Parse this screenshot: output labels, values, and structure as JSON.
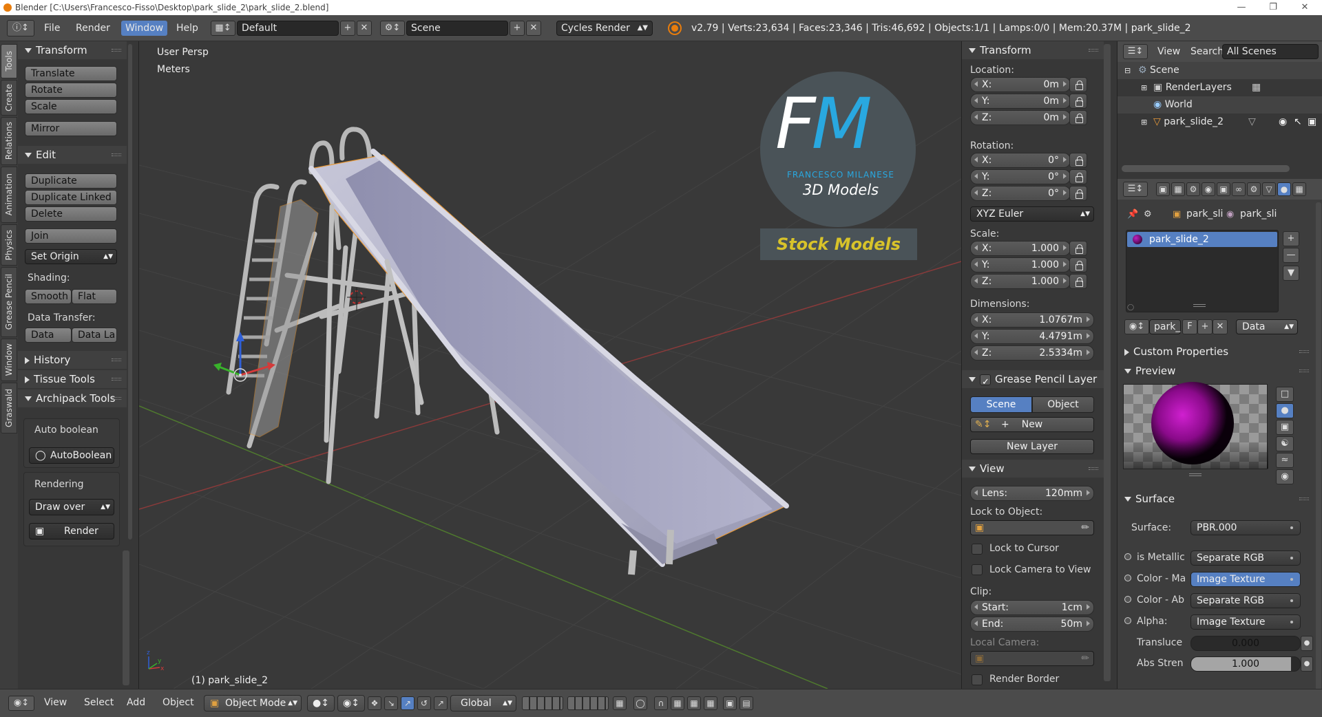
{
  "titlebar": {
    "title": "Blender [C:\\Users\\Francesco-Fisso\\Desktop\\park_slide_2\\park_slide_2.blend]"
  },
  "menubar": {
    "items": [
      "File",
      "Render",
      "Window",
      "Help"
    ],
    "active_item": "Window",
    "layout": "Default",
    "scene": "Scene",
    "engine": "Cycles Render",
    "stats": "v2.79 | Verts:23,634 | Faces:23,346 | Tris:46,692 | Objects:1/1 | Lamps:0/0 | Mem:20.37M | park_slide_2"
  },
  "tabs": [
    "Tools",
    "Create",
    "Relations",
    "Animation",
    "Physics",
    "Grease Pencil",
    "Window",
    "Graswald"
  ],
  "toolshelf": {
    "transform": {
      "title": "Transform",
      "buttons": [
        "Translate",
        "Rotate",
        "Scale",
        "Mirror"
      ]
    },
    "edit": {
      "title": "Edit",
      "buttons": [
        "Duplicate",
        "Duplicate Linked",
        "Delete",
        "Join"
      ],
      "set_origin": "Set Origin",
      "shading_label": "Shading:",
      "smooth": "Smooth",
      "flat": "Flat",
      "data_transfer_label": "Data Transfer:",
      "data": "Data",
      "data_la": "Data La"
    },
    "history": "History",
    "tissue": "Tissue Tools",
    "archipack": "Archipack Tools",
    "auto_boolean": "Auto boolean",
    "autoboolean_btn": "AutoBoolean",
    "rendering": "Rendering",
    "draw_over": "Draw over",
    "render": "Render"
  },
  "viewport": {
    "view_name": "User Persp",
    "units": "Meters",
    "object_label": "(1) park_slide_2",
    "watermark": {
      "initials_f": "F",
      "initials_m": "M",
      "name": "FRANCESCO MILANESE",
      "tagline": "3D Models",
      "banner": "Stock Models"
    }
  },
  "npanel": {
    "transform_title": "Transform",
    "location_label": "Location:",
    "location": [
      {
        "k": "X:",
        "v": "0m"
      },
      {
        "k": "Y:",
        "v": "0m"
      },
      {
        "k": "Z:",
        "v": "0m"
      }
    ],
    "rotation_label": "Rotation:",
    "rotation": [
      {
        "k": "X:",
        "v": "0°"
      },
      {
        "k": "Y:",
        "v": "0°"
      },
      {
        "k": "Z:",
        "v": "0°"
      }
    ],
    "rotation_mode": "XYZ Euler",
    "scale_label": "Scale:",
    "scale": [
      {
        "k": "X:",
        "v": "1.000"
      },
      {
        "k": "Y:",
        "v": "1.000"
      },
      {
        "k": "Z:",
        "v": "1.000"
      }
    ],
    "dimensions_label": "Dimensions:",
    "dimensions": [
      {
        "k": "X:",
        "v": "1.0767m"
      },
      {
        "k": "Y:",
        "v": "4.4791m"
      },
      {
        "k": "Z:",
        "v": "2.5334m"
      }
    ],
    "grease_title": "Grease Pencil Layer",
    "gp_scene": "Scene",
    "gp_object": "Object",
    "gp_new": "New",
    "gp_new_layer": "New Layer",
    "view_title": "View",
    "lens_k": "Lens:",
    "lens_v": "120mm",
    "lock_object": "Lock to Object:",
    "lock_cursor": "Lock to Cursor",
    "lock_camera": "Lock Camera to View",
    "clip_label": "Clip:",
    "clip_start_k": "Start:",
    "clip_start_v": "1cm",
    "clip_end_k": "End:",
    "clip_end_v": "50m",
    "local_camera": "Local Camera:",
    "render_border": "Render Border"
  },
  "outliner": {
    "view": "View",
    "search": "Search",
    "scope": "All Scenes",
    "items": [
      "Scene",
      "RenderLayers",
      "World",
      "park_slide_2"
    ]
  },
  "properties": {
    "crumb1": "park_sli",
    "crumb2": "park_sli",
    "material_slot": "park_slide_2",
    "mat_name": "park_",
    "mat_f": "F",
    "data_dropdown": "Data",
    "custom_props": "Custom Properties",
    "preview": "Preview",
    "surface_title": "Surface",
    "rows": [
      {
        "k": "Surface:",
        "v": "PBR.000"
      },
      {
        "k": "is Metallic",
        "v": "Separate RGB"
      },
      {
        "k": "Color - Ma",
        "v": "Image Texture"
      },
      {
        "k": "Color - Ab",
        "v": "Separate RGB"
      },
      {
        "k": "Alpha:",
        "v": "Image Texture"
      }
    ],
    "translu_k": "Transluce",
    "translu_v": "0.000",
    "translu_frac": 0.0,
    "abs_k": "Abs Stren",
    "abs_v": "1.000",
    "abs_frac": 0.92
  },
  "footer": {
    "items": [
      "View",
      "Select",
      "Add",
      "Object"
    ],
    "mode": "Object Mode",
    "orientation": "Global"
  },
  "colors": {
    "accent": "#5680c2",
    "brand_cyan": "#29a8e0",
    "banner_yellow": "#d8c32a",
    "axis_red": "#b03434",
    "axis_green": "#5a9a2e",
    "selection_orange": "#e89a3a"
  }
}
